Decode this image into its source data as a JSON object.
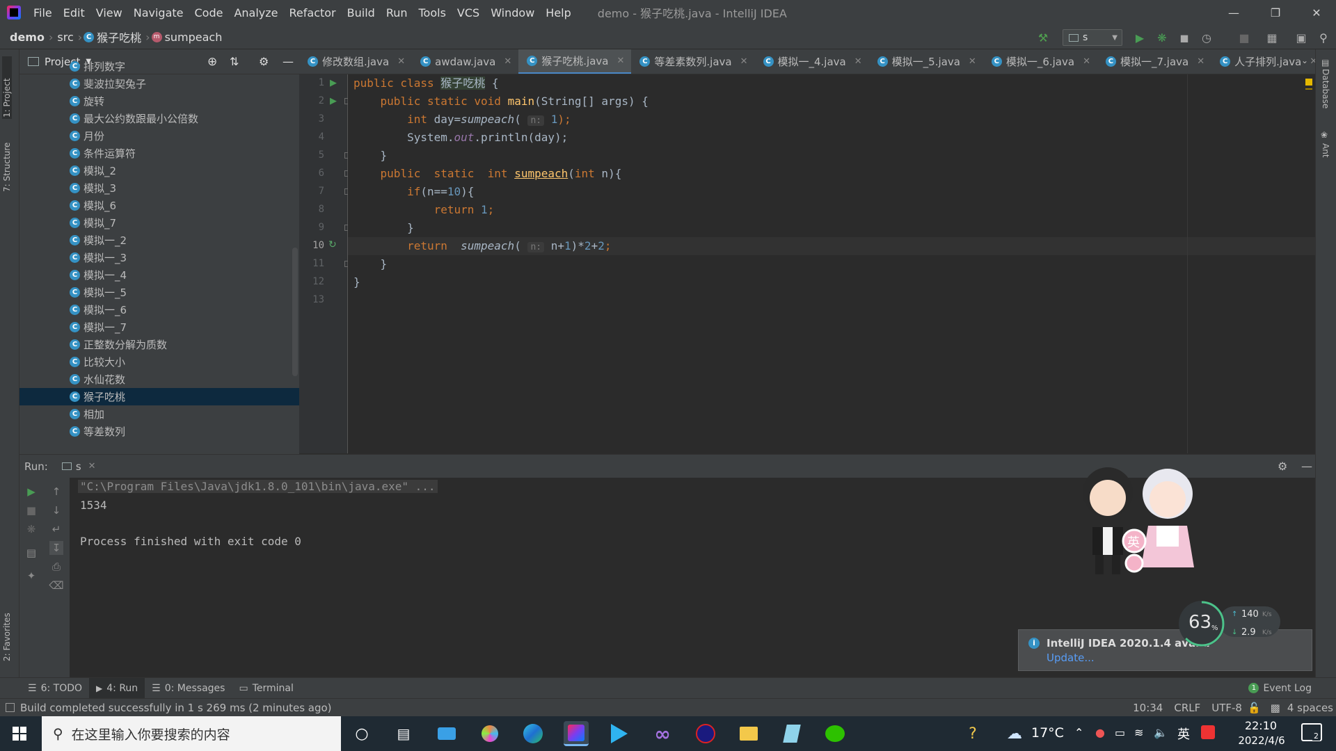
{
  "window": {
    "title": "demo - 猴子吃桃.java - IntelliJ IDEA",
    "menu": [
      "File",
      "Edit",
      "View",
      "Navigate",
      "Code",
      "Analyze",
      "Refactor",
      "Build",
      "Run",
      "Tools",
      "VCS",
      "Window",
      "Help"
    ]
  },
  "breadcrumb": {
    "project": "demo",
    "src": "src",
    "class": "猴子吃桃",
    "method": "sumpeach"
  },
  "toolbar": {
    "run_config": "s"
  },
  "left_strip": {
    "project": "1: Project",
    "structure": "7: Structure",
    "favorites": "2: Favorites"
  },
  "right_strip": {
    "database": "Database",
    "ant": "Ant"
  },
  "project_panel": {
    "title": "Project",
    "items": [
      "排列数字",
      "斐波拉契兔子",
      "旋转",
      "最大公约数跟最小公倍数",
      "月份",
      "条件运算符",
      "模拟_2",
      "模拟_3",
      "模拟_6",
      "模拟_7",
      "模拟一_2",
      "模拟一_3",
      "模拟一_4",
      "模拟一_5",
      "模拟一_6",
      "模拟一_7",
      "正整数分解为质数",
      "比较大小",
      "水仙花数",
      "猴子吃桃",
      "相加",
      "等差数列"
    ],
    "selected_index": 19
  },
  "tabs": [
    "修改数组.java",
    "awdaw.java",
    "猴子吃桃.java",
    "等差素数列.java",
    "模拟一_4.java",
    "模拟一_5.java",
    "模拟一_6.java",
    "模拟一_7.java",
    "人子排列.java"
  ],
  "active_tab_index": 2,
  "editor": {
    "line_numbers": [
      "1",
      "2",
      "3",
      "4",
      "5",
      "6",
      "7",
      "8",
      "9",
      "10",
      "11",
      "12",
      "13"
    ],
    "current_line": "10",
    "code": {
      "l1_kw": "public class ",
      "l1_name": "猴子吃桃",
      "l1_rest": " {",
      "l2_kw": "    public static void ",
      "l2_fn": "main",
      "l2_rest": "(String[] args) {",
      "l3_kw": "        int ",
      "l3_a": "day=",
      "l3_call": "sumpeach",
      "l3_b": "( ",
      "l3_hint": "n:",
      "l3_num": " 1",
      "l3_c": ");",
      "l4_a": "        System.",
      "l4_out": "out",
      "l4_b": ".println(day);",
      "l5": "    }",
      "l6_kw": "    public  static  int ",
      "l6_fn": "sumpeach",
      "l6_a": "(",
      "l6_kw2": "int",
      "l6_b": " n){",
      "l7_kw": "        if",
      "l7_a": "(n==",
      "l7_num": "10",
      "l7_b": "){",
      "l8_kw": "            return ",
      "l8_num": "1",
      "l8_b": ";",
      "l9": "        }",
      "l10_kw": "        return  ",
      "l10_call": "sumpeach",
      "l10_a": "( ",
      "l10_hint": "n:",
      "l10_b": " n+",
      "l10_num1": "1",
      "l10_c": ")*",
      "l10_num2": "2",
      "l10_d": "+",
      "l10_num3": "2",
      "l10_e": ";",
      "l11": "    }",
      "l12": "}",
      "l13": ""
    }
  },
  "run_panel": {
    "label": "Run:",
    "tab": "s",
    "console": [
      "\"C:\\Program Files\\Java\\jdk1.8.0_101\\bin\\java.exe\" ...",
      "1534",
      "",
      "Process finished with exit code 0"
    ]
  },
  "bottom_tabs": {
    "todo": "6: TODO",
    "run": "4: Run",
    "messages": "0: Messages",
    "terminal": "Terminal",
    "event_log": "Event Log",
    "event_count": "1"
  },
  "status": {
    "message": "Build completed successfully in 1 s 269 ms (2 minutes ago)",
    "position": "10:34",
    "line_sep": "CRLF",
    "encoding": "UTF-8",
    "indent": "4 spaces"
  },
  "notification": {
    "title": "IntelliJ IDEA 2020.1.4 availa",
    "link": "Update..."
  },
  "net_widget": {
    "percent": "63",
    "percent_unit": "%",
    "up": "140",
    "down": "2.9",
    "unit": "K/s"
  },
  "mascot": {
    "badge": "英"
  },
  "taskbar": {
    "search_placeholder": "在这里输入你要搜索的内容",
    "weather": "17°C",
    "ime": "英",
    "time": "22:10",
    "date": "2022/4/6",
    "notif_count": "2"
  },
  "colors": {
    "accent": "#4a88c7",
    "keyword": "#cc7832",
    "function": "#ffc66d",
    "number": "#6897bb",
    "static_field": "#9876aa",
    "run_green": "#499c54"
  }
}
